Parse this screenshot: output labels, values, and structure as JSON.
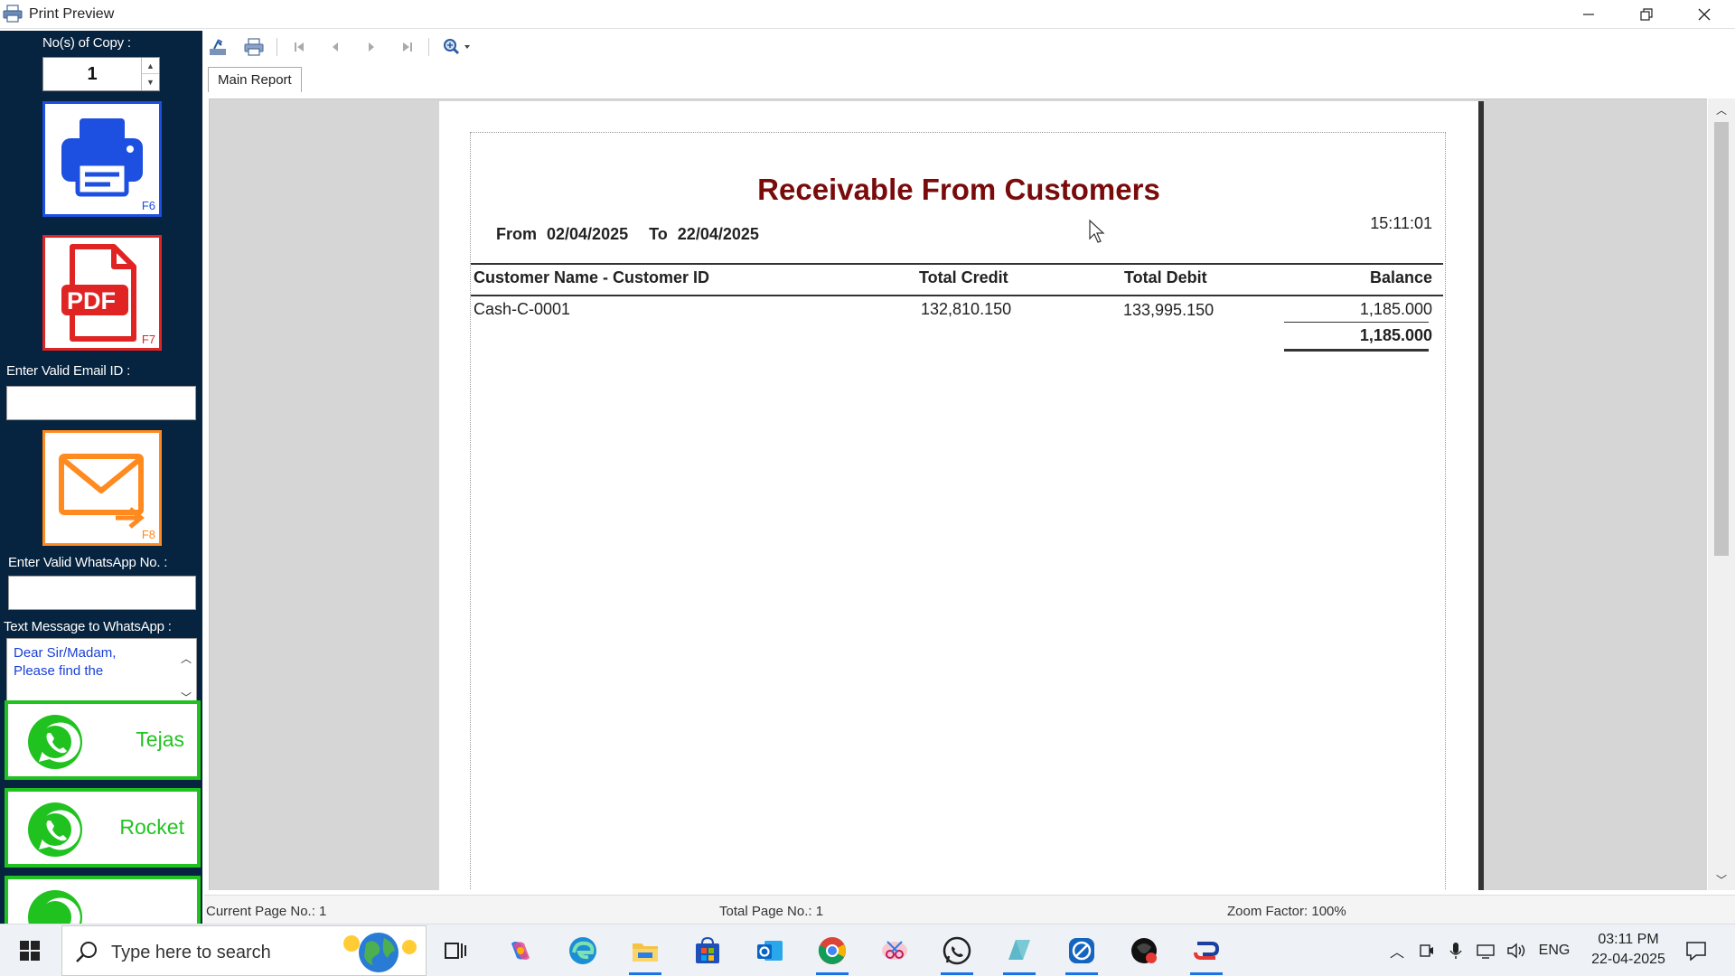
{
  "window": {
    "title": "Print Preview"
  },
  "left_panel": {
    "copies_label": "No(s) of Copy :",
    "copies_value": "1",
    "print_key": "F6",
    "pdf_key": "F7",
    "pdf_text": "PDF",
    "email_label": "Enter Valid Email ID :",
    "email_value": "",
    "email_key": "F8",
    "whatsapp_label": "Enter Valid WhatsApp No. :",
    "whatsapp_value": "",
    "message_label": "Text Message to WhatsApp :",
    "message_line1": "Dear Sir/Madam,",
    "message_line2": "Please find the",
    "whatsapp_buttons": [
      "Tejas",
      "Rocket"
    ]
  },
  "toolbar": {
    "icons": [
      "export-icon",
      "print-icon",
      "first-page-icon",
      "prev-page-icon",
      "next-page-icon",
      "last-page-icon",
      "zoom-icon"
    ]
  },
  "tabs": [
    "Main Report"
  ],
  "report": {
    "title": "Receivable From Customers",
    "from_label": "From",
    "from_date": "02/04/2025",
    "to_label": "To",
    "to_date": "22/04/2025",
    "time": "15:11:01",
    "columns": [
      "Customer Name - Customer ID",
      "Total Credit",
      "Total Debit",
      "Balance"
    ],
    "rows": [
      {
        "customer": "Cash-C-0001",
        "credit": "132,810.150",
        "debit": "133,995.150",
        "balance": "1,185.000"
      }
    ],
    "total_balance": "1,185.000"
  },
  "status_bar": {
    "current_page": "Current Page No.: 1",
    "total_page": "Total Page No.: 1",
    "zoom": "Zoom Factor: 100%"
  },
  "taskbar": {
    "search_placeholder": "Type here to search",
    "language": "ENG",
    "time": "03:11 PM",
    "date": "22-04-2025"
  },
  "colors": {
    "panel_bg": "#06233f",
    "title_red": "#7a0b0b",
    "whatsapp_green": "#1fc21f",
    "print_blue": "#1d4fe0",
    "pdf_red": "#e02424",
    "email_orange": "#ff8a1f"
  }
}
